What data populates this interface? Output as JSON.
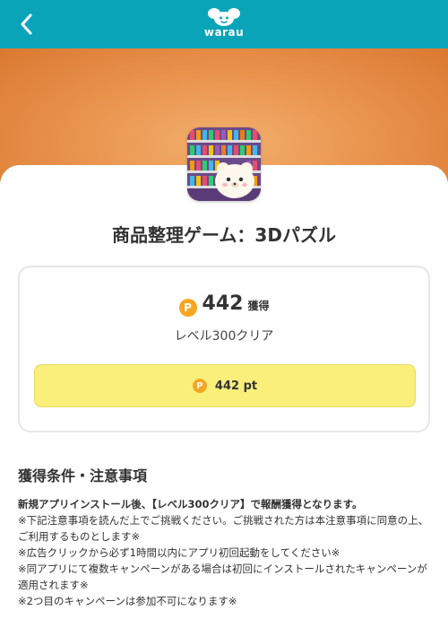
{
  "header": {
    "logo_text": "warau",
    "back_icon": "chevron-left-icon",
    "background_color": "#0aa4b8"
  },
  "app": {
    "title": "商品整理ゲーム：3Dパズル"
  },
  "reward": {
    "coin_symbol": "P",
    "points": "442",
    "points_unit": "獲得",
    "condition": "レベル300クリア",
    "button_label": "442 pt",
    "button_color": "#f9ef7a",
    "coin_color": "#f5a623"
  },
  "notes": {
    "section_title": "獲得条件・注意事項",
    "lead": "新規アプリインストール後、【レベル300クリア】で報酬獲得となります。",
    "lines": [
      "※下記注意事項を読んだ上でご挑戦ください。ご挑戦された方は本注意事項に同意の上、ご利用するものとします※",
      "※広告クリックから必ず1時間以内にアプリ初回起動をしてください※",
      "※同アプリにて複数キャンペーンがある場合は初回にインストールされたキャンペーンが適用されます※",
      "※2つ目のキャンペーンは参加不可になります※"
    ]
  }
}
